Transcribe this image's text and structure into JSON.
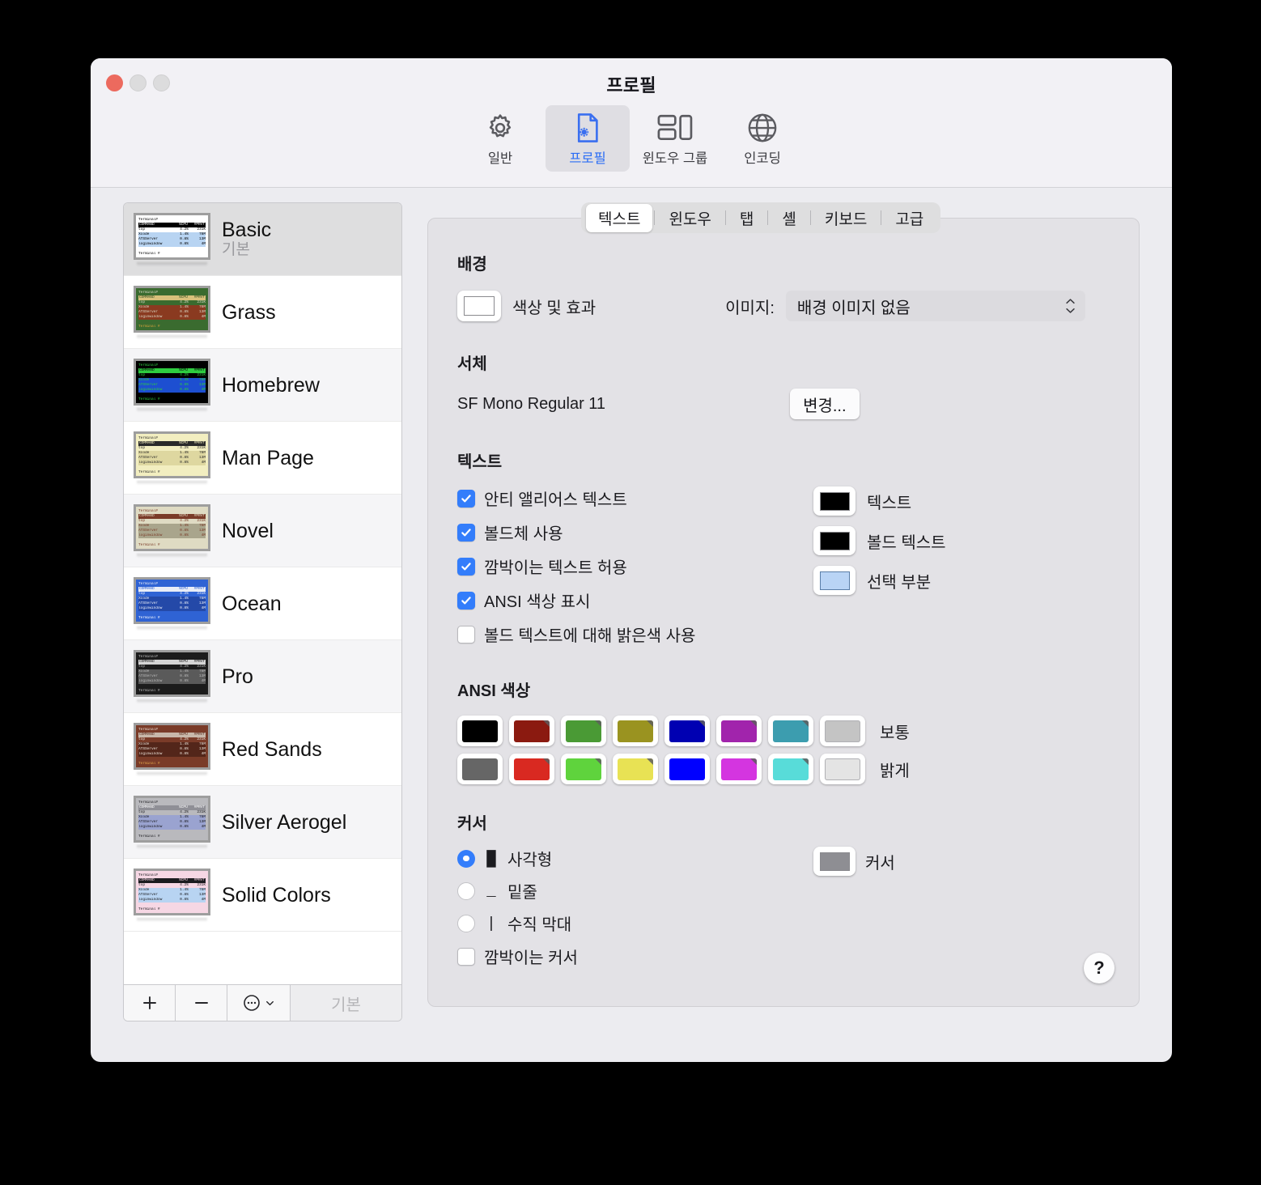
{
  "window": {
    "title": "프로필",
    "traffic_lights": [
      "close",
      "minimize",
      "zoom"
    ]
  },
  "toolbar": {
    "items": [
      {
        "label": "일반",
        "icon": "gear-icon",
        "selected": false
      },
      {
        "label": "프로필",
        "icon": "document-gear-icon",
        "selected": true
      },
      {
        "label": "윈도우 그룹",
        "icon": "window-group-icon",
        "selected": false
      },
      {
        "label": "인코딩",
        "icon": "globe-icon",
        "selected": false
      }
    ]
  },
  "sidebar": {
    "profiles": [
      {
        "name": "Basic",
        "subtitle": "기본",
        "selected": true,
        "bg": "#ffffff",
        "fg": "#000000",
        "hdr_bg": "#000000",
        "hdr_fg": "#ffffff",
        "sel_bg": "#b8d4f2",
        "prompt_fg": "#000000"
      },
      {
        "name": "Grass",
        "subtitle": "",
        "selected": false,
        "bg": "#3a6b2f",
        "fg": "#d9d7c5",
        "hdr_bg": "#d9c07a",
        "hdr_fg": "#2b4f22",
        "sel_bg": "#8a3a20",
        "prompt_fg": "#d6a23c"
      },
      {
        "name": "Homebrew",
        "subtitle": "",
        "selected": false,
        "bg": "#000000",
        "fg": "#2ecc40",
        "hdr_bg": "#2ecc40",
        "hdr_fg": "#000000",
        "sel_bg": "#1d4fd1",
        "prompt_fg": "#2ecc40"
      },
      {
        "name": "Man Page",
        "subtitle": "",
        "selected": false,
        "bg": "#f2eec0",
        "fg": "#2a2a2a",
        "hdr_bg": "#2a2a2a",
        "hdr_fg": "#f2eec0",
        "sel_bg": "#ded7a0",
        "prompt_fg": "#2a2a2a"
      },
      {
        "name": "Novel",
        "subtitle": "",
        "selected": false,
        "bg": "#dfdbc3",
        "fg": "#7a3b28",
        "hdr_bg": "#7a3b28",
        "hdr_fg": "#dfdbc3",
        "sel_bg": "#a9a58c",
        "prompt_fg": "#7a3b28"
      },
      {
        "name": "Ocean",
        "subtitle": "",
        "selected": false,
        "bg": "#2f63d4",
        "fg": "#e9edf7",
        "hdr_bg": "#e9edf7",
        "hdr_fg": "#2f63d4",
        "sel_bg": "#2449a8",
        "prompt_fg": "#ffffff"
      },
      {
        "name": "Pro",
        "subtitle": "",
        "selected": false,
        "bg": "#1c1c1c",
        "fg": "#b9b9b9",
        "hdr_bg": "#d5d5d5",
        "hdr_fg": "#1c1c1c",
        "sel_bg": "#5a5a5a",
        "prompt_fg": "#b9b9b9"
      },
      {
        "name": "Red Sands",
        "subtitle": "",
        "selected": false,
        "bg": "#7a3b28",
        "fg": "#e6ddd4",
        "hdr_bg": "#c8b8aa",
        "hdr_fg": "#5a2a1c",
        "sel_bg": "#53261a",
        "prompt_fg": "#e0a44a"
      },
      {
        "name": "Silver Aerogel",
        "subtitle": "",
        "selected": false,
        "bg": "#b9b9bd",
        "fg": "#1b1b1f",
        "hdr_bg": "#8f8f96",
        "hdr_fg": "#ffffff",
        "sel_bg": "#9aa3d0",
        "prompt_fg": "#1b1b1f"
      },
      {
        "name": "Solid Colors",
        "subtitle": "",
        "selected": false,
        "bg": "#f6d7e4",
        "fg": "#1b1b1f",
        "hdr_bg": "#1b1b1f",
        "hdr_fg": "#f6d7e4",
        "sel_bg": "#b8d4f2",
        "prompt_fg": "#1b1b1f"
      }
    ],
    "thumbnail": {
      "title_line": "Terminal#",
      "header": {
        "command": "COMMAND",
        "cpu": "%CPU",
        "prvt": "#PRVT"
      },
      "rows": [
        {
          "command": "top",
          "cpu": "4.2%",
          "prvt": "231K",
          "highlighted": false
        },
        {
          "command": "Xcode",
          "cpu": "1.4%",
          "prvt": "78M",
          "highlighted": true
        },
        {
          "command": "ATSServer",
          "cpu": "0.8%",
          "prvt": "13M",
          "highlighted": true
        },
        {
          "command": "loginwindow",
          "cpu": "0.8%",
          "prvt": "4M",
          "highlighted": true
        }
      ],
      "prompt": "Terminal #"
    },
    "footer": {
      "add_label": "+",
      "remove_label": "−",
      "actions_label": "⋯",
      "default_label": "기본"
    }
  },
  "tabs": [
    {
      "label": "텍스트",
      "active": true
    },
    {
      "label": "윈도우",
      "active": false
    },
    {
      "label": "탭",
      "active": false
    },
    {
      "label": "셸",
      "active": false
    },
    {
      "label": "키보드",
      "active": false
    },
    {
      "label": "고급",
      "active": false
    }
  ],
  "background": {
    "heading": "배경",
    "color_effects_label": "색상 및 효과",
    "color_well": "#ffffff",
    "image_label": "이미지:",
    "image_value": "배경 이미지 없음"
  },
  "font": {
    "heading": "서체",
    "value": "SF Mono Regular 11",
    "change_button": "변경..."
  },
  "text_section": {
    "heading": "텍스트",
    "checkboxes": [
      {
        "label": "안티 앨리어스 텍스트",
        "checked": true
      },
      {
        "label": "볼드체 사용",
        "checked": true
      },
      {
        "label": "깜박이는 텍스트 허용",
        "checked": true
      },
      {
        "label": "ANSI 색상 표시",
        "checked": true
      },
      {
        "label": "볼드 텍스트에 대해 밝은색 사용",
        "checked": false
      }
    ],
    "color_wells": [
      {
        "label": "텍스트",
        "color": "#000000"
      },
      {
        "label": "볼드 텍스트",
        "color": "#000000"
      },
      {
        "label": "선택 부분",
        "color": "#b9d4f5"
      }
    ]
  },
  "ansi": {
    "heading": "ANSI 색상",
    "rows": [
      {
        "label": "보통",
        "colors": [
          "#000000",
          "#8b1a10",
          "#4a9a35",
          "#9a9320",
          "#0000b2",
          "#a124ac",
          "#3c9daf",
          "#c4c4c4"
        ],
        "flags": [
          false,
          true,
          true,
          true,
          true,
          true,
          true,
          false
        ]
      },
      {
        "label": "밝게",
        "colors": [
          "#666666",
          "#d92921",
          "#5fd33d",
          "#e8e254",
          "#0000ff",
          "#d435e0",
          "#58dcd9",
          "#e4e4e4"
        ],
        "flags": [
          false,
          true,
          true,
          true,
          false,
          true,
          true,
          false
        ]
      }
    ]
  },
  "cursor": {
    "heading": "커서",
    "options": [
      {
        "label": "사각형",
        "glyph": "█",
        "selected": true
      },
      {
        "label": "밑줄",
        "glyph": "_",
        "selected": false
      },
      {
        "label": "수직 막대",
        "glyph": "|",
        "selected": false
      }
    ],
    "blink": {
      "label": "깜박이는 커서",
      "checked": false
    },
    "color_well": {
      "label": "커서",
      "color": "#8e8e93"
    }
  },
  "help": {
    "label": "?"
  },
  "colors": {
    "accent": "#337dfb",
    "window_bg": "#ececf0",
    "panel_bg": "#e3e2e6",
    "titlebar_bg": "#f2f1f5"
  }
}
